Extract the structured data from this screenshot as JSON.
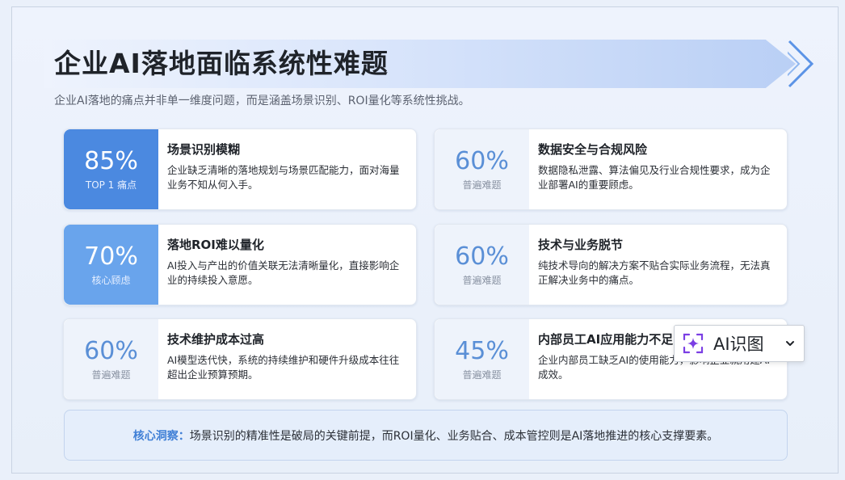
{
  "header": {
    "title": "企业AI落地面临系统性难题",
    "subtitle": "企业AI落地的痛点并非单一维度问题，而是涵盖场景识别、ROI量化等系统性挑战。"
  },
  "cards": [
    {
      "percent": "85%",
      "tag": "TOP 1 痛点",
      "title": "场景识别模糊",
      "desc": "企业缺乏清晰的落地规划与场景匹配能力，面对海量业务不知从何入手。"
    },
    {
      "percent": "60%",
      "tag": "普遍难题",
      "title": "数据安全与合规风险",
      "desc": "数据隐私泄露、算法偏见及行业合规性要求，成为企业部署AI的重要顾虑。"
    },
    {
      "percent": "70%",
      "tag": "核心顾虑",
      "title": "落地ROI难以量化",
      "desc": "AI投入与产出的价值关联无法清晰量化，直接影响企业的持续投入意愿。"
    },
    {
      "percent": "60%",
      "tag": "普遍难题",
      "title": "技术与业务脱节",
      "desc": "纯技术导向的解决方案不贴合实际业务流程，无法真正解决业务中的痛点。"
    },
    {
      "percent": "60%",
      "tag": "普遍难题",
      "title": "技术维护成本过高",
      "desc": "AI模型迭代快，系统的持续维护和硬件升级成本往往超出企业预算预期。"
    },
    {
      "percent": "45%",
      "tag": "普遍难题",
      "title": "内部员工AI应用能力不足",
      "desc": "企业内部员工缺乏AI的使用能力，影响企业就用建AI成效。"
    }
  ],
  "insight": {
    "label": "核心洞察：",
    "text": "场景识别的精准性是破局的关键前提，而ROI量化、业务贴合、成本管控则是AI落地推进的核心支撑要素。"
  },
  "ai_widget": {
    "label": "AI识图",
    "icon": "sparkle-scan-icon",
    "chevron": "chevron-down-icon"
  },
  "colors": {
    "accent_dark": "#4b89e0",
    "accent_mid": "#69a4ec",
    "accent_light": "#eef3fb",
    "insight_label": "#3f7fd6",
    "ai_icon": "#7b3fe4"
  }
}
